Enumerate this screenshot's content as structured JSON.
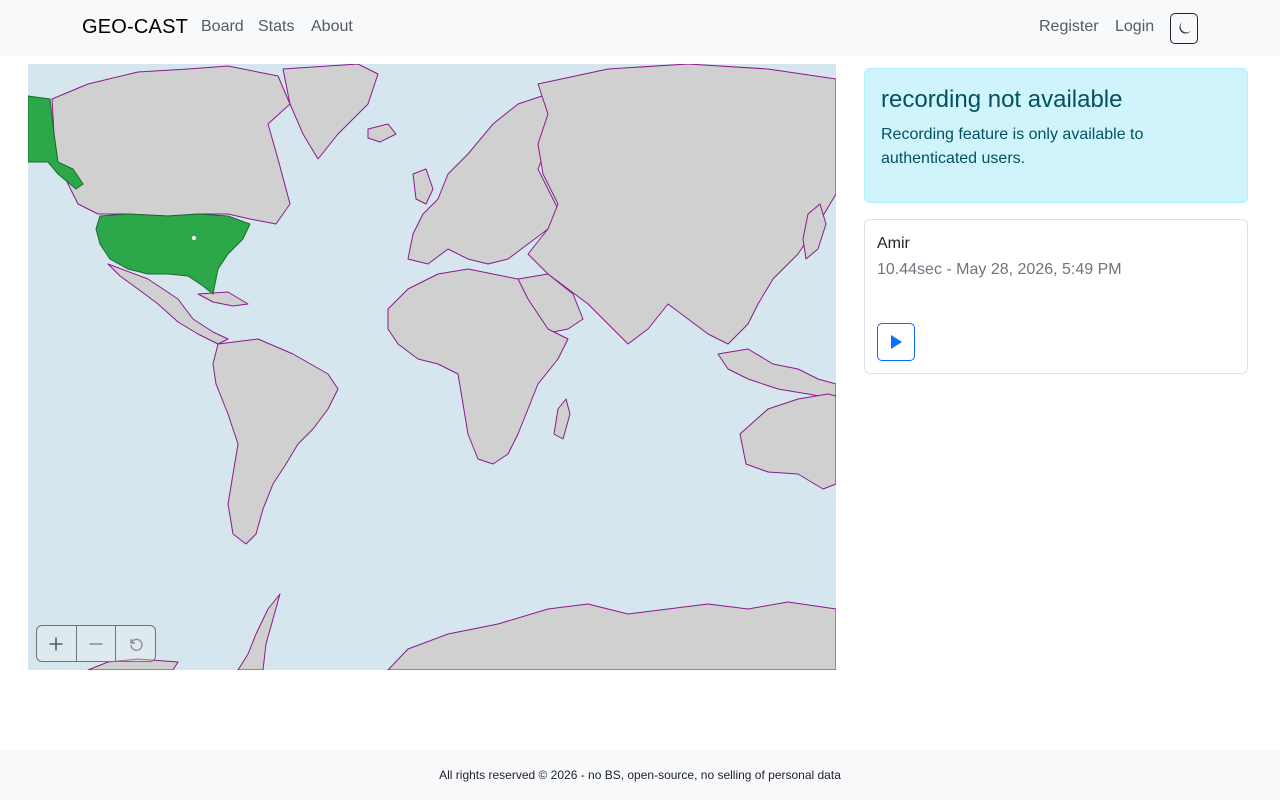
{
  "navbar": {
    "brand": "GEO-CAST",
    "left_links": [
      {
        "label": "Board"
      },
      {
        "label": "Stats"
      },
      {
        "label": "About"
      }
    ],
    "right_links": [
      {
        "label": "Register"
      },
      {
        "label": "Login"
      }
    ],
    "theme_toggle_icon": "moon-icon"
  },
  "map": {
    "ocean_color": "#d6e6ef",
    "land_color": "#d0d0d0",
    "border_color": "#8b1a8b",
    "highlight_color": "#2ca84a",
    "highlighted_country": "United States",
    "controls": [
      {
        "icon": "plus-icon"
      },
      {
        "icon": "minus-icon"
      },
      {
        "icon": "reset-icon"
      }
    ]
  },
  "alert": {
    "title": "recording not available",
    "text": "Recording feature is only available to authenticated users."
  },
  "recording_card": {
    "name": "Amir",
    "detail": "10.44sec - May 28, 2026, 5:49 PM",
    "play_icon": "play-icon"
  },
  "footer": {
    "text": "All rights reserved © 2026 - no BS, open-source, no selling of personal data"
  }
}
